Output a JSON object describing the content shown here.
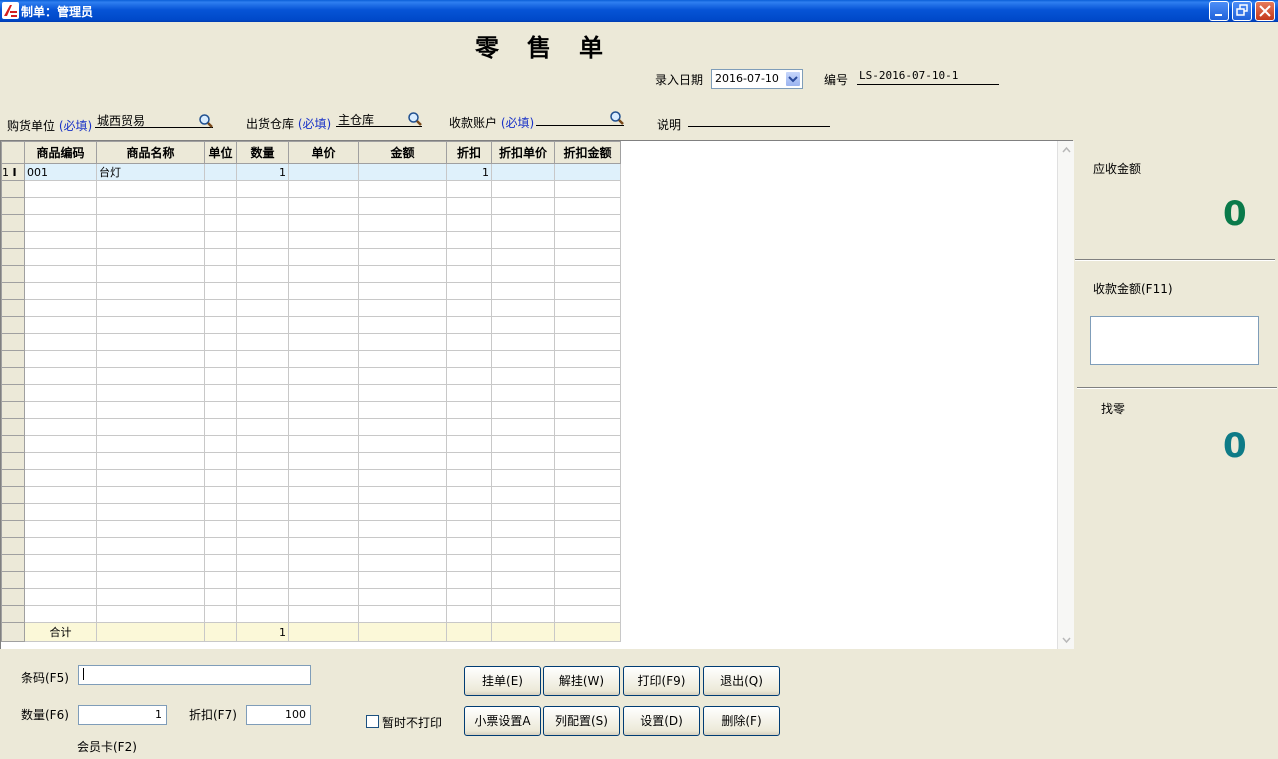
{
  "window": {
    "title": "制单：管理员"
  },
  "header": {
    "doc_title": "零售单",
    "date_label": "录入日期",
    "date_value": "2016-07-10",
    "number_label": "编号",
    "number_value": "LS-2016-07-10-1",
    "buyer_label": "购货单位",
    "buyer_required": "(必填)",
    "buyer_value": "城西贸易",
    "warehouse_label": "出货仓库",
    "warehouse_required": "(必填)",
    "warehouse_value": "主仓库",
    "account_label": "收款账户",
    "account_required": "(必填)",
    "account_value": "",
    "note_label": "说明",
    "note_value": ""
  },
  "grid": {
    "columns": [
      "商品编码",
      "商品名称",
      "单位",
      "数量",
      "单价",
      "金额",
      "折扣",
      "折扣单价",
      "折扣金额"
    ],
    "rows": [
      {
        "row_no": "1",
        "code": "001",
        "name": "台灯",
        "unit": "",
        "qty": "1",
        "price": "",
        "amount": "",
        "discount": "1",
        "disc_price": "",
        "disc_amount": ""
      }
    ],
    "total": {
      "label": "合计",
      "qty": "1"
    }
  },
  "summary": {
    "receivable_label": "应收金额",
    "receivable_value": "0",
    "received_label": "收款金额(F11)",
    "received_value": "",
    "change_label": "找零",
    "change_value": "0"
  },
  "bottom": {
    "barcode_label": "条码(F5)",
    "barcode_value": "",
    "qty_label": "数量(F6)",
    "qty_value": "1",
    "discount_label": "折扣(F7)",
    "discount_value": "100",
    "member_label": "会员卡(F2)",
    "noprint_label": "暂时不打印",
    "buttons": {
      "hold": "挂单(E)",
      "unhold": "解挂(W)",
      "print": "打印(F9)",
      "exit": "退出(Q)",
      "ticket_settings": "小票设置A",
      "columns": "列配置(S)",
      "settings": "设置(D)",
      "delete": "删除(F)"
    }
  },
  "colors": {
    "accent_green": "#0a7a4a",
    "change_teal": "#0e7b87",
    "required_blue": "#1a33c8"
  }
}
